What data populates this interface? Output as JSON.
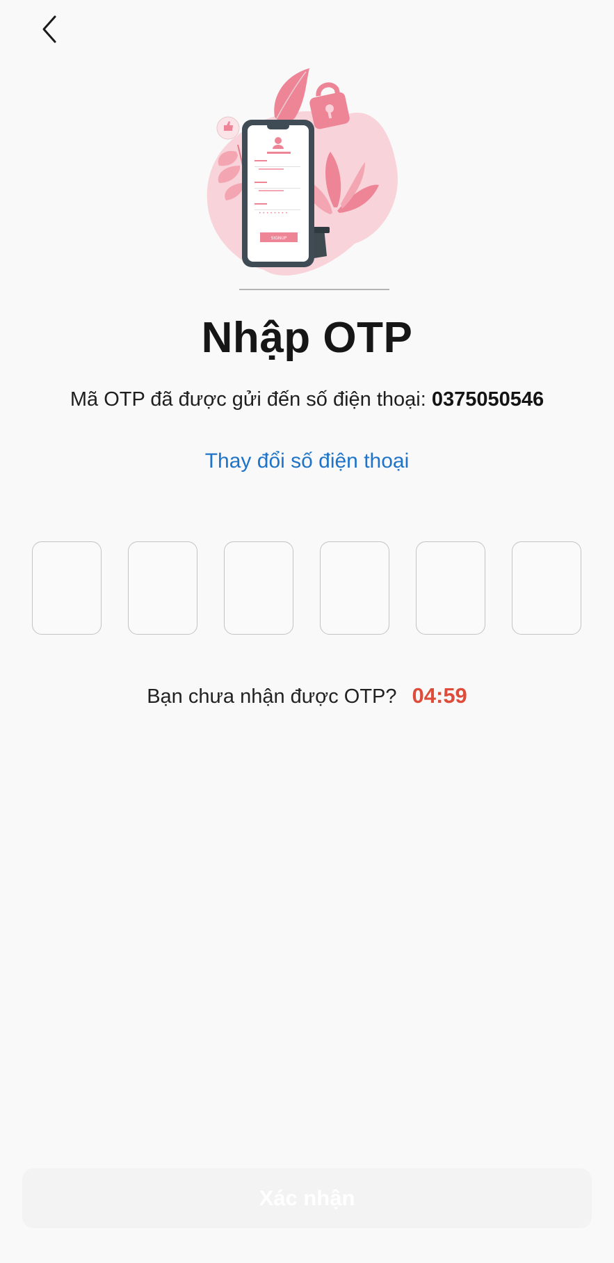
{
  "header": {
    "back_icon": "chevron-left-icon"
  },
  "illustration": {
    "button_text": "SIGNUP",
    "accent_color": "#f08a9a"
  },
  "main": {
    "title": "Nhập OTP",
    "subtitle_prefix": "Mã OTP đã được gửi đến số điện thoại: ",
    "phone_number": "0375050546",
    "change_phone_label": "Thay đổi số điện thoại",
    "otp_digits": [
      "",
      "",
      "",
      "",
      "",
      ""
    ],
    "resend_prompt": "Bạn chưa nhận được OTP?",
    "timer": "04:59"
  },
  "footer": {
    "confirm_label": "Xác nhận"
  },
  "colors": {
    "link": "#1e74c8",
    "timer": "#de4d3a",
    "button_disabled": "#f3f3f3"
  }
}
